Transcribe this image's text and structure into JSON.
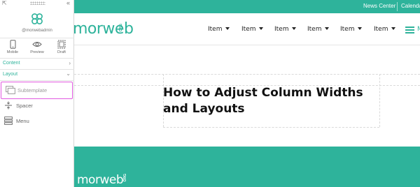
{
  "topbar": {
    "links": [
      "News Center",
      "Calendar"
    ]
  },
  "site": {
    "logo_text": "morweb",
    "logo_org": "ORG",
    "nav_items": [
      "Item",
      "Item",
      "Item",
      "Item",
      "Item",
      "Item"
    ],
    "menu_label": "M",
    "page_title": "How to Adjust Column Widths and Layouts",
    "footer_logo_text": "morweb",
    "footer_logo_org": "ORG"
  },
  "panel": {
    "username": "@morwebadmin",
    "modes": [
      {
        "label": "Mobile",
        "icon": "mobile-icon"
      },
      {
        "label": "Preview",
        "icon": "eye-icon"
      },
      {
        "label": "Draft",
        "icon": "draft-icon"
      }
    ],
    "sections": {
      "content": "Content",
      "layout": "Layout"
    },
    "layout_items": [
      {
        "label": "Subtemplate",
        "icon": "subtemplate-icon",
        "selected": true
      },
      {
        "label": "Spacer",
        "icon": "spacer-icon"
      },
      {
        "label": "Menu",
        "icon": "menu-icon"
      }
    ]
  },
  "colors": {
    "brand": "#2eb39b",
    "selection": "#e15ae0"
  }
}
